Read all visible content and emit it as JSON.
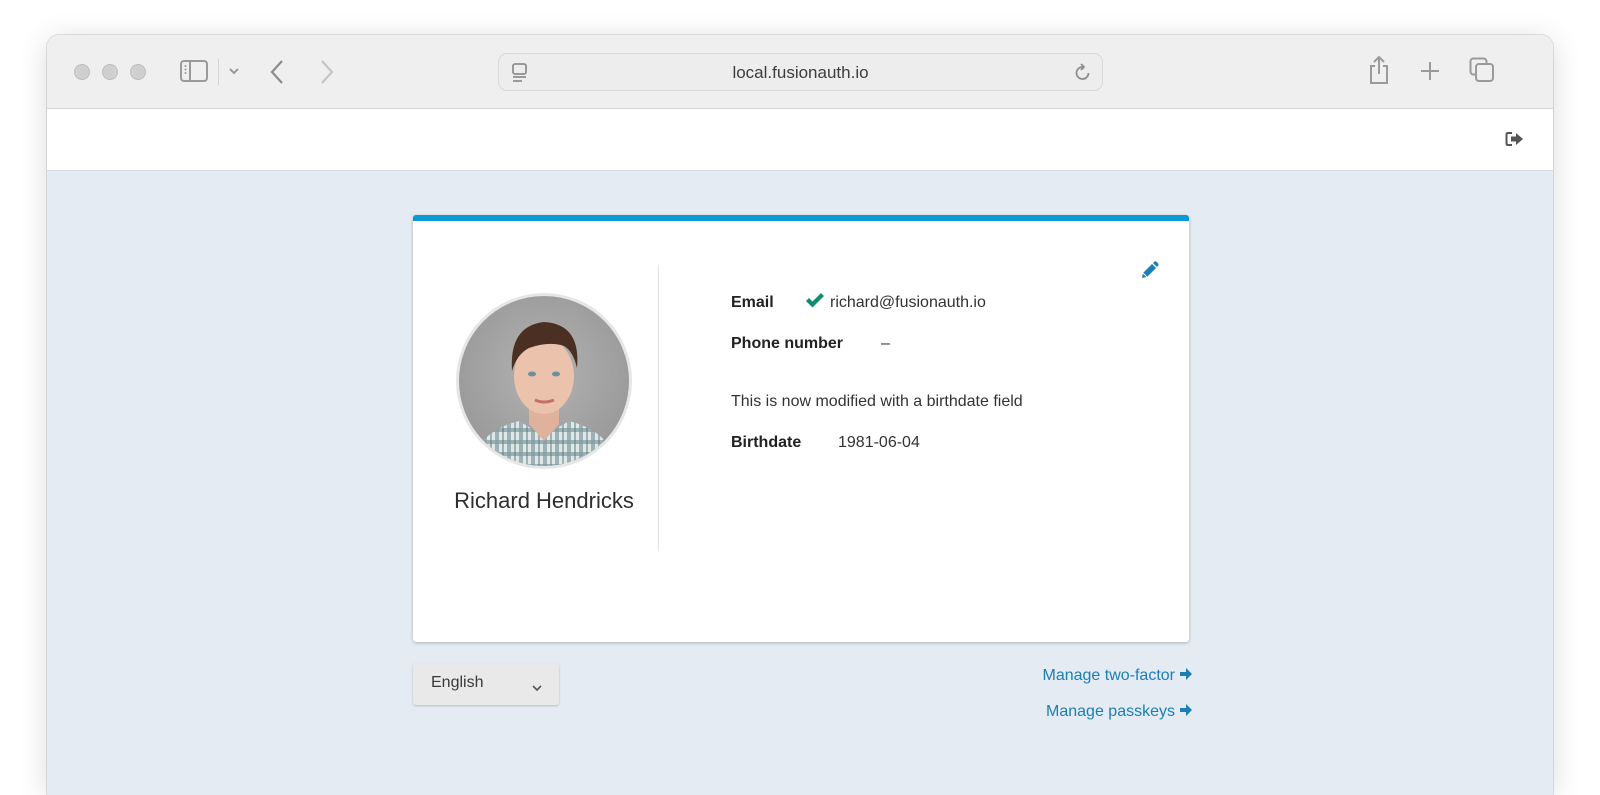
{
  "browser": {
    "url": "local.fusionauth.io",
    "icons": {
      "window_controls": [
        "close",
        "minimize",
        "maximize"
      ],
      "sidebar": "sidebar-icon",
      "sidebar_menu": "chevron-down-icon",
      "back": "chevron-left-icon",
      "forward": "chevron-right-icon",
      "site": "site-settings-icon",
      "reload": "reload-icon",
      "share": "share-icon",
      "new_tab": "plus-icon",
      "tabs_overview": "tabs-overview-icon"
    }
  },
  "header": {
    "logout_icon": "sign-out-icon"
  },
  "profile": {
    "name": "Richard Hendricks",
    "avatar_alt": "Richard Hendricks profile photo",
    "edit_icon": "pencil-icon",
    "fields": {
      "email": {
        "label": "Email",
        "value": "richard@fusionauth.io",
        "verified": true
      },
      "phone": {
        "label": "Phone number",
        "value": "–"
      },
      "note": "This is now modified with a birthdate field",
      "birthdate": {
        "label": "Birthdate",
        "value": "1981-06-04"
      }
    }
  },
  "footer": {
    "language": {
      "selected": "English"
    },
    "links": {
      "two_factor": "Manage two-factor",
      "passkeys": "Manage passkeys"
    }
  },
  "colors": {
    "accent": "#0a98d6",
    "link": "#1a7fb5",
    "verified": "#128b6e",
    "background": "#e4ebf2"
  }
}
